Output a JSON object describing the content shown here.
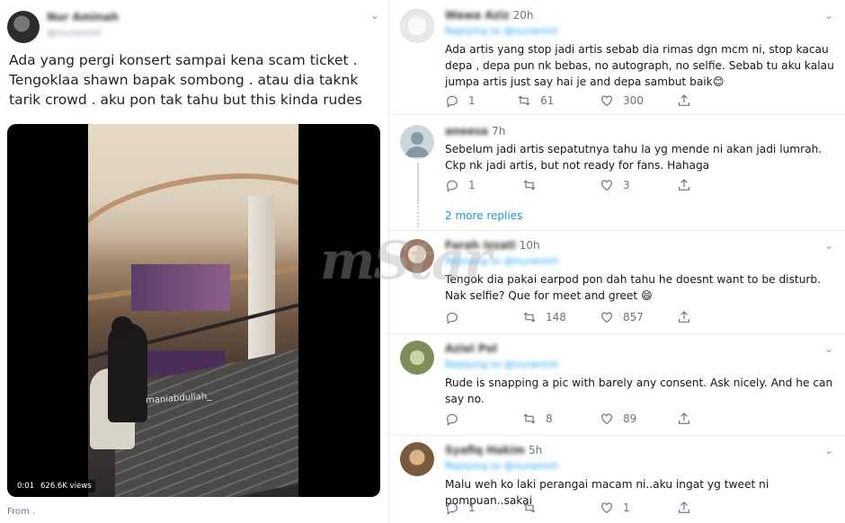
{
  "original_tweet": {
    "author_name": "Nur Aminah",
    "author_handle": "@nuramnh",
    "text": "Ada yang pergi konsert sampai kena scam ticket . Tengoklaa shawn bapak sombong . atau dia taknk tarik crowd . aku pon tak tahu but this kinda rudes",
    "video": {
      "time": "0:01",
      "views": "626.6K views",
      "watermark": "maniabdullah_"
    },
    "footer": "From ."
  },
  "replies": [
    {
      "name": "Wawa Aziz",
      "handle": "Replying to @nuramnh",
      "time": "20h",
      "text": "Ada artis yang stop jadi artis sebab dia rimas dgn mcm ni, stop kacau depa , depa pun nk bebas, no autograph, no selfie. Sebab tu aku kalau jumpa artis just say hai je and depa sambut baik😊",
      "replies": "1",
      "retweets": "61",
      "likes": "300"
    },
    {
      "name": "aneesa",
      "handle": "",
      "time": "7h",
      "text": "Sebelum jadi artis sepatutnya tahu la yg mende ni akan jadi lumrah. Ckp nk jadi artis, but not ready for fans. Hahaga",
      "replies": "1",
      "retweets": "",
      "likes": "3"
    },
    {
      "name": "Farah Izzati",
      "handle": "Replying to @nuramnh",
      "time": "10h",
      "text": "Tengok dia pakai earpod pon dah tahu he doesnt want to be disturb. Nak selfie? Que for meet and greet 😄",
      "replies": "",
      "retweets": "148",
      "likes": "857"
    },
    {
      "name": "Aziel Pol",
      "handle": "Replying to @nuramnh",
      "time": "",
      "text": "Rude is snapping a pic with barely any consent. Ask nicely. And he can say no.",
      "replies": "",
      "retweets": "8",
      "likes": "89"
    },
    {
      "name": "Syafiq Hakim",
      "handle": "Replying to @nuramnh",
      "time": "5h",
      "text": "Malu weh ko laki perangai macam ni..aku ingat yg tweet ni pompuan..sakai",
      "replies": "1",
      "retweets": "",
      "likes": "1"
    }
  ],
  "more_replies": "2 more replies",
  "watermark_brand": "mStar",
  "colors": {
    "link": "#1b95e0",
    "muted": "#657786",
    "border": "#e6ecf0"
  }
}
